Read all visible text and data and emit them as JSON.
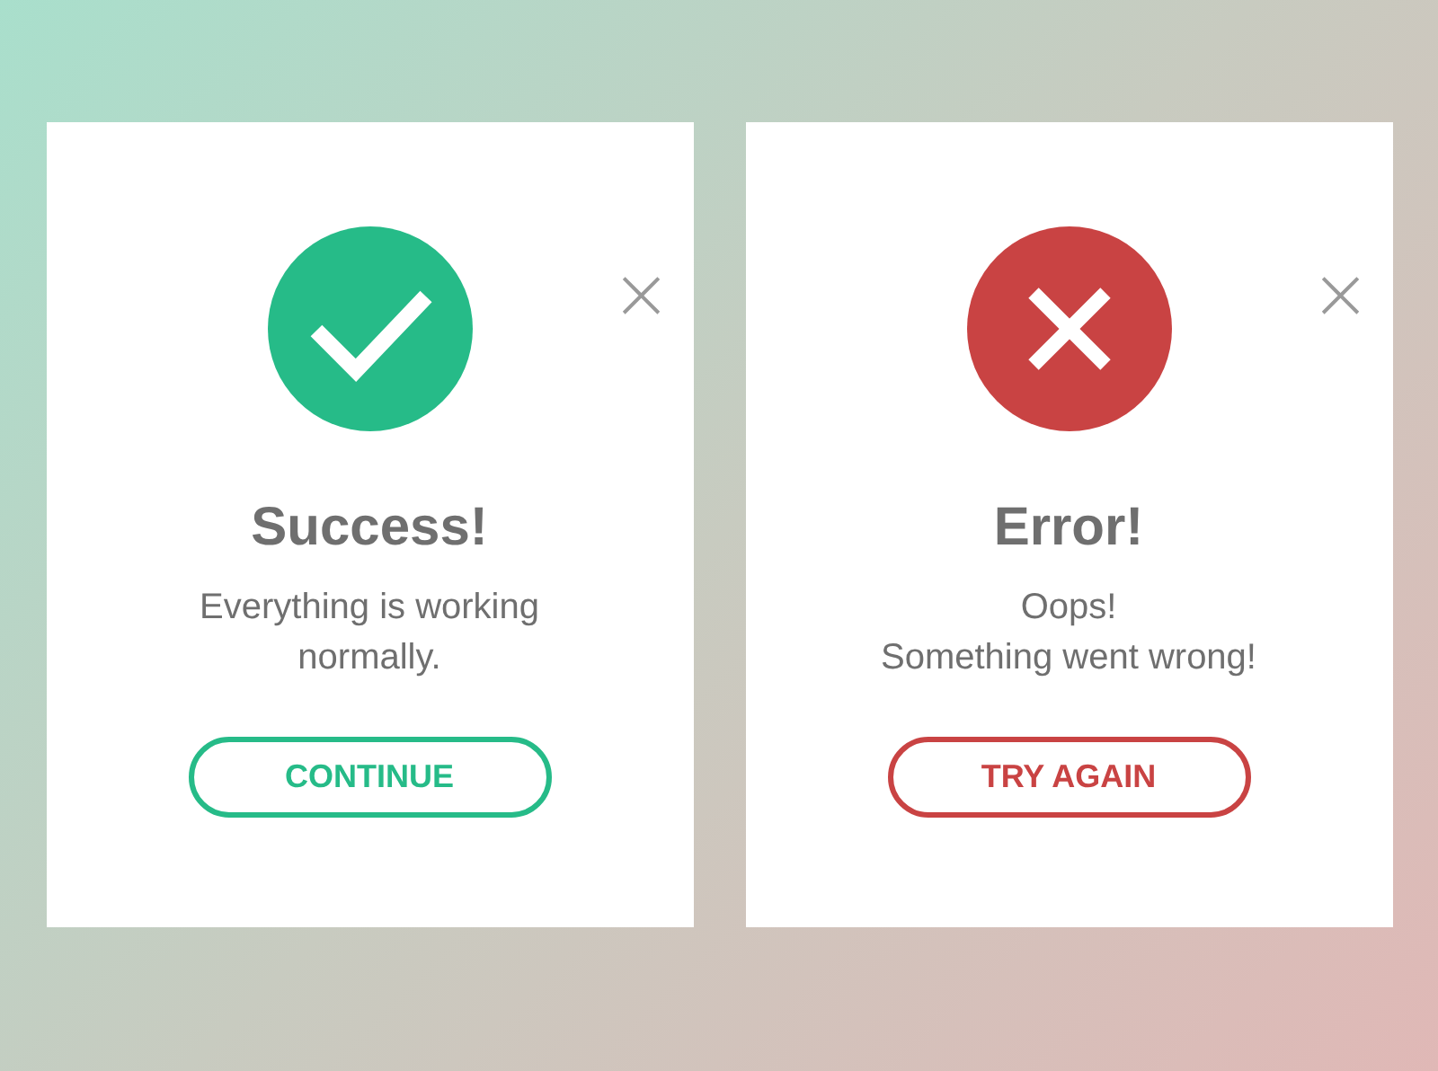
{
  "dialogs": [
    {
      "kind": "success",
      "color": "#26bb88",
      "close": "×",
      "title": "Success!",
      "message": "Everything is working normally.",
      "button": "CONTINUE"
    },
    {
      "kind": "error",
      "color": "#c94343",
      "close": "×",
      "title": "Error!",
      "message": "Oops!\nSomething went wrong!",
      "button": "TRY AGAIN"
    }
  ]
}
